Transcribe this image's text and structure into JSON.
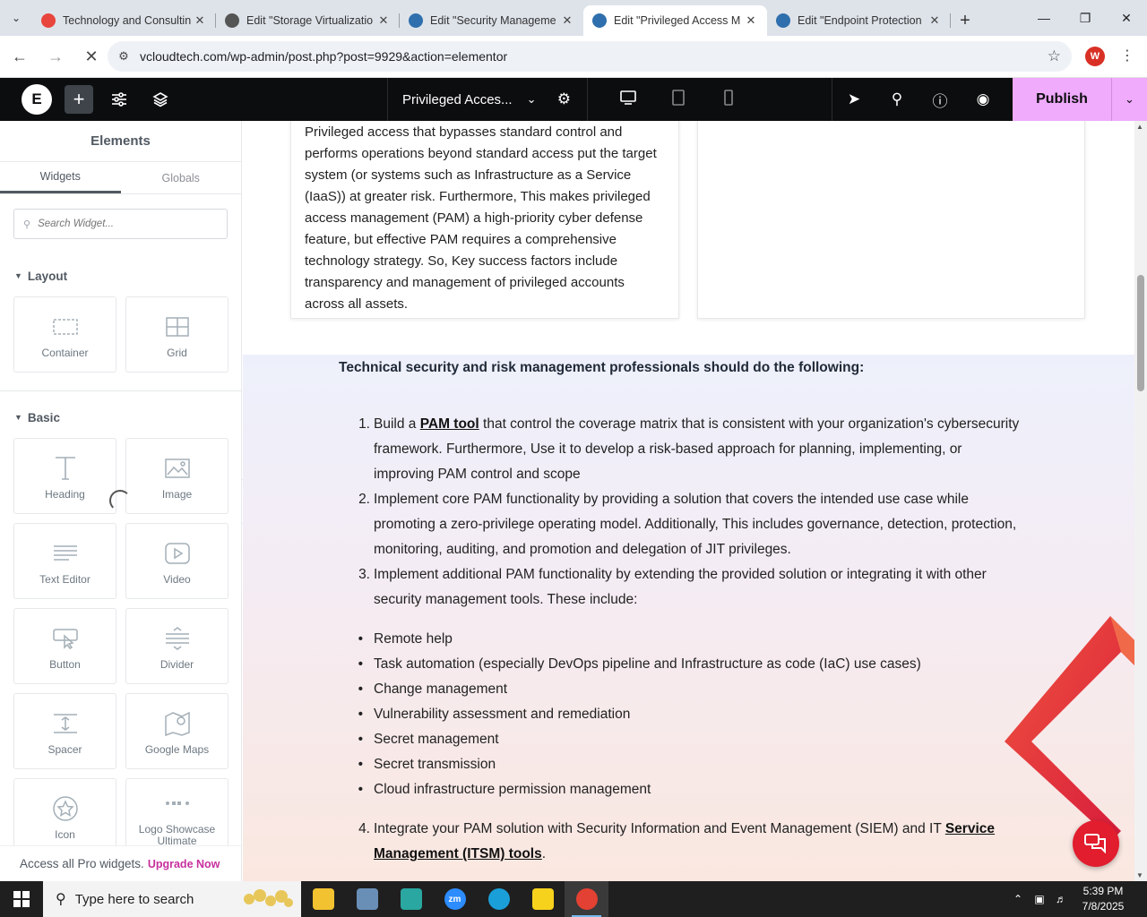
{
  "browser": {
    "tabs": [
      {
        "title": "Technology and Consultin",
        "favicon_color": "#e8453c"
      },
      {
        "title": "Edit \"Storage Virtualizatio",
        "favicon_color": "#555555"
      },
      {
        "title": "Edit \"Security Manageme",
        "favicon_color": "#2f6fad"
      },
      {
        "title": "Edit \"Privileged Access M",
        "favicon_color": "#2f6fad"
      },
      {
        "title": "Edit \"Endpoint Protection",
        "favicon_color": "#2f6fad"
      }
    ],
    "active_tab": 3,
    "url": "vcloudtech.com/wp-admin/post.php?post=9929&action=elementor",
    "profile_initial": "W"
  },
  "editor": {
    "logo": "E",
    "document_title": "Privileged Acces...",
    "publish_label": "Publish",
    "accent_color": "#f0abfc"
  },
  "panel": {
    "title": "Elements",
    "tabs": [
      "Widgets",
      "Globals"
    ],
    "search_placeholder": "Search Widget...",
    "categories": [
      {
        "name": "Layout",
        "widgets": [
          {
            "label": "Container",
            "icon": "container-icon"
          },
          {
            "label": "Grid",
            "icon": "grid-icon"
          }
        ]
      },
      {
        "name": "Basic",
        "widgets": [
          {
            "label": "Heading",
            "icon": "heading-icon"
          },
          {
            "label": "Image",
            "icon": "image-icon"
          },
          {
            "label": "Text Editor",
            "icon": "text-editor-icon"
          },
          {
            "label": "Video",
            "icon": "video-icon"
          },
          {
            "label": "Button",
            "icon": "button-icon"
          },
          {
            "label": "Divider",
            "icon": "divider-icon"
          },
          {
            "label": "Spacer",
            "icon": "spacer-icon"
          },
          {
            "label": "Google Maps",
            "icon": "map-icon"
          },
          {
            "label": "Icon",
            "icon": "star-icon"
          },
          {
            "label": "Logo Showcase Ultimate",
            "icon": "logo-showcase-icon"
          }
        ]
      }
    ],
    "upgrade_text": "Access all Pro widgets.",
    "upgrade_link": "Upgrade Now"
  },
  "content": {
    "card_text": "Privileged access that bypasses standard control and performs operations beyond standard access put the target system (or systems such as Infrastructure as a Service (IaaS)) at greater risk. Furthermore, This makes privileged access management (PAM) a high-priority cyber defense feature, but effective PAM requires a comprehensive technology strategy. So, Key success factors include transparency and management of privileged accounts across all assets.",
    "heading": "Technical security and risk management professionals should do the following:",
    "items": [
      {
        "num": "1.",
        "pre": "Build a ",
        "link": "PAM tool",
        "post": " that control the coverage matrix that is consistent with your organization's cybersecurity framework. Furthermore, Use it to develop a risk-based approach for planning, implementing, or improving PAM control and scope"
      },
      {
        "num": "2.",
        "pre": "Implement core PAM functionality by providing a solution that covers the intended use case while promoting a zero-privilege operating model. Additionally, This includes governance, detection, protection, monitoring, auditing, and promotion and delegation of JIT privileges.",
        "link": "",
        "post": ""
      },
      {
        "num": "3.",
        "pre": "Implement additional PAM functionality by extending the provided solution or integrating it with other security management tools. These include:",
        "link": "",
        "post": ""
      }
    ],
    "bullets": [
      "Remote help",
      "Task automation (especially DevOps pipeline and Infrastructure as code (IaC) use cases)",
      "Change management",
      "Vulnerability assessment and remediation",
      "Secret management",
      "Secret transmission",
      "Cloud infrastructure permission management"
    ],
    "item4": {
      "num": "4.",
      "pre": "Integrate your PAM solution with Security Information and Event Management (SIEM) and IT ",
      "link": "Service Management (ITSM) tools",
      "post": "."
    }
  },
  "taskbar": {
    "search_placeholder": "Type here to search",
    "time": "5:39 PM",
    "date": "7/8/2025",
    "apps": [
      {
        "name": "file-explorer",
        "color": "#f2c231"
      },
      {
        "name": "app-2",
        "color": "#6a8fb7"
      },
      {
        "name": "app-3",
        "color": "#2aa7a0"
      },
      {
        "name": "zoom",
        "color": "#2d8cff",
        "label": "zm"
      },
      {
        "name": "edge",
        "color": "#1a9fd8"
      },
      {
        "name": "sticky-notes",
        "color": "#f7d21d"
      },
      {
        "name": "chrome",
        "color": "#e34133"
      }
    ]
  }
}
